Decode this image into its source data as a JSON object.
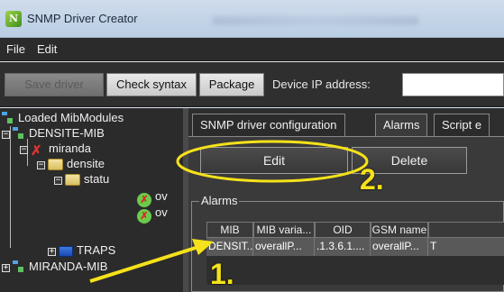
{
  "window": {
    "title": "SNMP Driver Creator"
  },
  "menu": {
    "items": [
      "File",
      "Edit"
    ]
  },
  "toolbar": {
    "save_label": "Save driver",
    "check_label": "Check syntax",
    "package_label": "Package",
    "device_ip_label": "Device IP address:",
    "device_ip_value": ""
  },
  "tree": {
    "root": "Loaded MibModules",
    "nodes": [
      "DENSITE-MIB",
      "miranda",
      "densite",
      "statu",
      "ov",
      "ov",
      "TRAPS",
      "MIRANDA-MIB"
    ]
  },
  "tabs": [
    "SNMP driver configuration",
    "Alarms",
    "Script e"
  ],
  "alarms_tab": {
    "edit_label": "Edit",
    "delete_label": "Delete",
    "group_label": "Alarms",
    "columns": [
      "MIB",
      "MIB varia...",
      "OID",
      "GSM name",
      ""
    ],
    "rows": [
      [
        "DENSIT...",
        "overallP...",
        ".1.3.6.1....",
        "overallP...",
        "T"
      ]
    ]
  },
  "annotations": {
    "step1": "1.",
    "step2": "2."
  },
  "colors": {
    "annotation": "#f5e21a",
    "panel": "#2e2e2e",
    "selected_row": "#595959"
  }
}
